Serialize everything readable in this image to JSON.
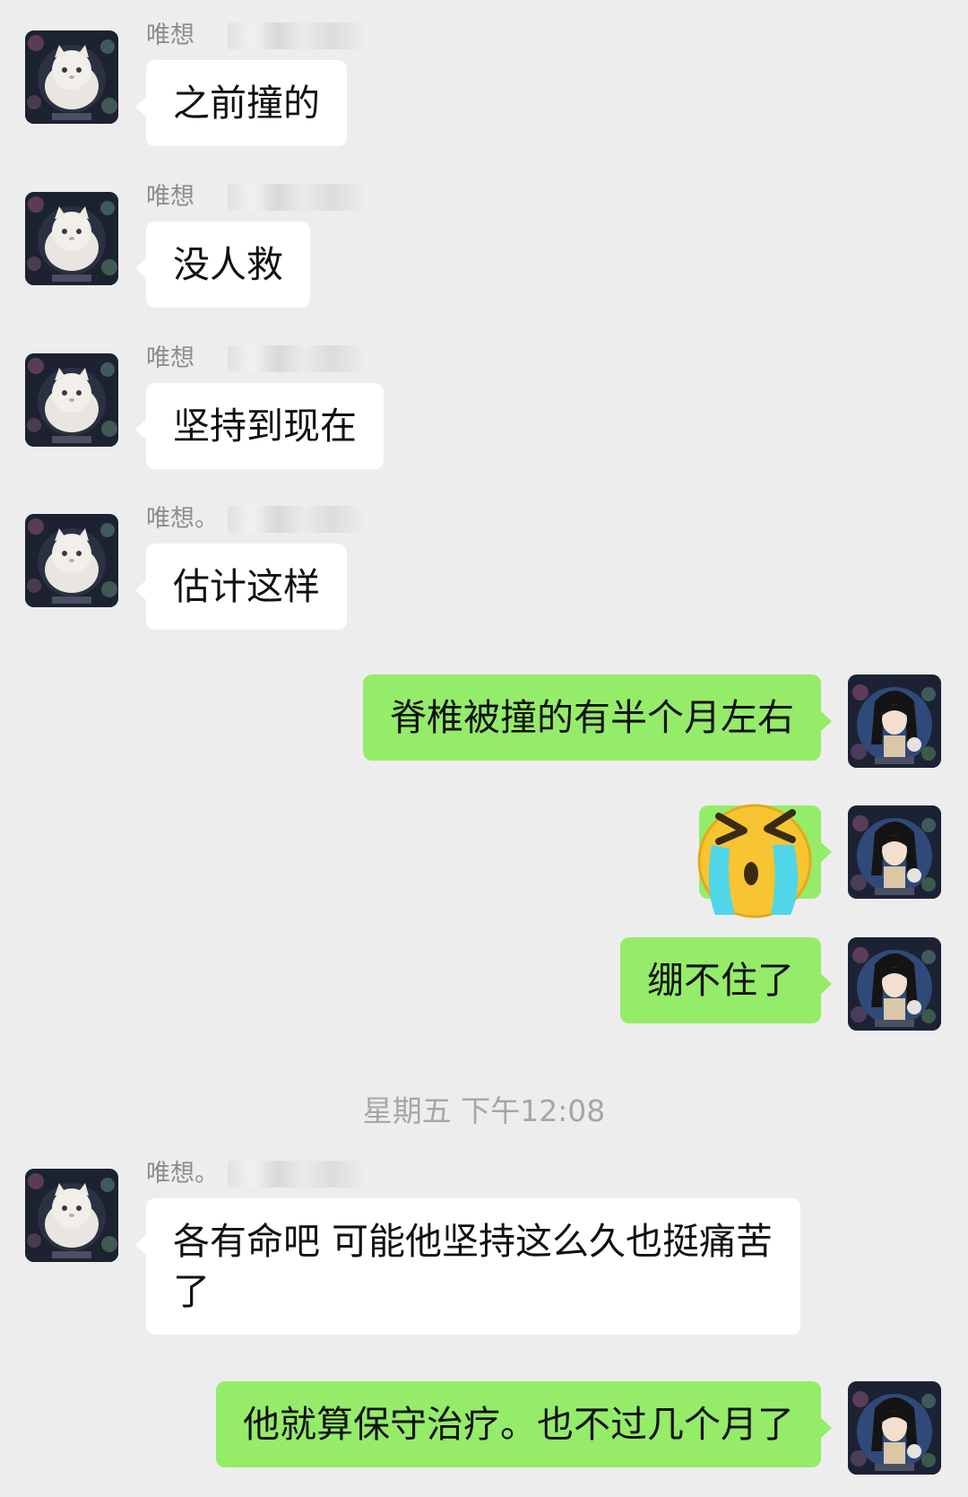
{
  "chat": {
    "timestamp": "星期五 下午12:08",
    "messages": [
      {
        "side": "in",
        "sender": "唯想",
        "text": "之前撞的"
      },
      {
        "side": "in",
        "sender": "唯想",
        "text": "没人救"
      },
      {
        "side": "in",
        "sender": "唯想",
        "text": "坚持到现在"
      },
      {
        "side": "in",
        "sender": "唯想。",
        "text": "估计这样"
      },
      {
        "side": "out",
        "text": "脊椎被撞的有半个月左右"
      },
      {
        "side": "out",
        "sticker": "crying-emoji-sticker"
      },
      {
        "side": "out",
        "text": "绷不住了"
      },
      {
        "side": "in",
        "sender": "唯想。",
        "text": "各有命吧 可能他坚持这么久也挺痛苦了"
      },
      {
        "side": "out",
        "text": "他就算保守治疗。也不过几个月了"
      }
    ]
  },
  "colors": {
    "background": "#ededed",
    "incoming_bubble": "#ffffff",
    "outgoing_bubble": "#95ec69",
    "timestamp": "#a6a6a6"
  },
  "icons": {
    "incoming_avatar": "white-cat-avatar-icon",
    "outgoing_avatar": "anime-character-avatar-icon"
  }
}
